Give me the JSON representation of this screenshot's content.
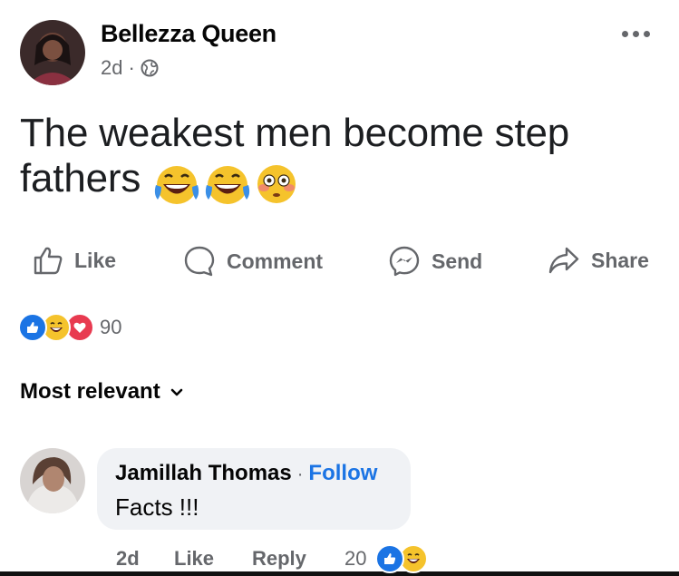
{
  "post": {
    "author": "Bellezza Queen",
    "time": "2d",
    "separator": "·",
    "audience_icon": "globe-icon",
    "text": "The weakest men become step fathers",
    "emojis": [
      "laughing-crying-face",
      "laughing-crying-face",
      "flushed-face"
    ]
  },
  "actions": {
    "like": "Like",
    "comment": "Comment",
    "send": "Send",
    "share": "Share"
  },
  "reactions": {
    "types": [
      "like",
      "haha",
      "love"
    ],
    "count": "90"
  },
  "sort": {
    "label": "Most relevant"
  },
  "comment": {
    "author": "Jamillah Thomas",
    "separator": "·",
    "follow": "Follow",
    "text": "Facts !!!",
    "time": "2d",
    "like": "Like",
    "reply": "Reply",
    "reaction_count": "20",
    "reaction_types": [
      "like",
      "haha"
    ]
  },
  "colors": {
    "accent": "#1b74e4",
    "secondary_text": "#65676b",
    "bubble": "#f0f2f5"
  }
}
